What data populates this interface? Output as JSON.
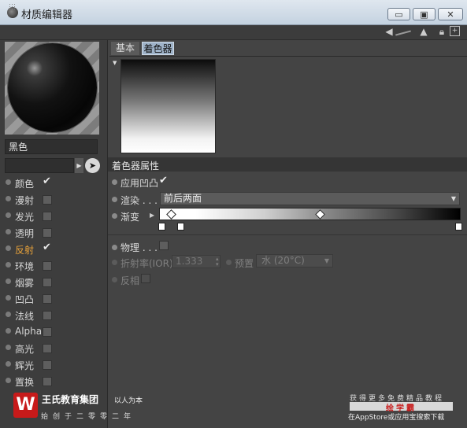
{
  "window": {
    "title": "材质编辑器",
    "buttons": {
      "minimize": "▭",
      "maximize": "▣",
      "close": "✕"
    }
  },
  "material": {
    "name": "黑色"
  },
  "channels": [
    {
      "label": "颜色",
      "checked": true
    },
    {
      "label": "漫射",
      "checked": false
    },
    {
      "label": "发光",
      "checked": false
    },
    {
      "label": "透明",
      "checked": false
    },
    {
      "label": "反射",
      "checked": true,
      "active": true
    },
    {
      "label": "环境",
      "checked": false
    },
    {
      "label": "烟雾",
      "checked": false
    },
    {
      "label": "凹凸",
      "checked": false
    },
    {
      "label": "法线",
      "checked": false
    },
    {
      "label": "Alpha",
      "checked": false
    },
    {
      "label": "高光",
      "checked": false
    },
    {
      "label": "辉光",
      "checked": false
    },
    {
      "label": "置换",
      "checked": false
    }
  ],
  "tabs": [
    {
      "label": "基本",
      "active": false
    },
    {
      "label": "着色器",
      "active": true
    }
  ],
  "shader": {
    "section_title": "着色器属性",
    "apply_bump_label": "应用凹凸",
    "render_label": "渲染 . . .",
    "render_value": "前后两面",
    "gradient_label": "渐变",
    "physical_label": "物理 . . .",
    "ior_label": "折射率(IOR)",
    "ior_value": "1.333",
    "preset_label": "预置",
    "preset_value": "水 (20°C)",
    "invert_label": "反相"
  },
  "colors": {
    "accent": "#e7a13a",
    "tab_active": "#9fb3c9"
  },
  "watermark": {
    "logo": "W",
    "company": "王氏教育集团",
    "slogan": "以人为本",
    "founded": "始创于二零零二年",
    "promo1": "获得更多免费精品教程",
    "promo2": "绘学霸",
    "promo3": "在AppStore或应用宝搜索下载"
  }
}
